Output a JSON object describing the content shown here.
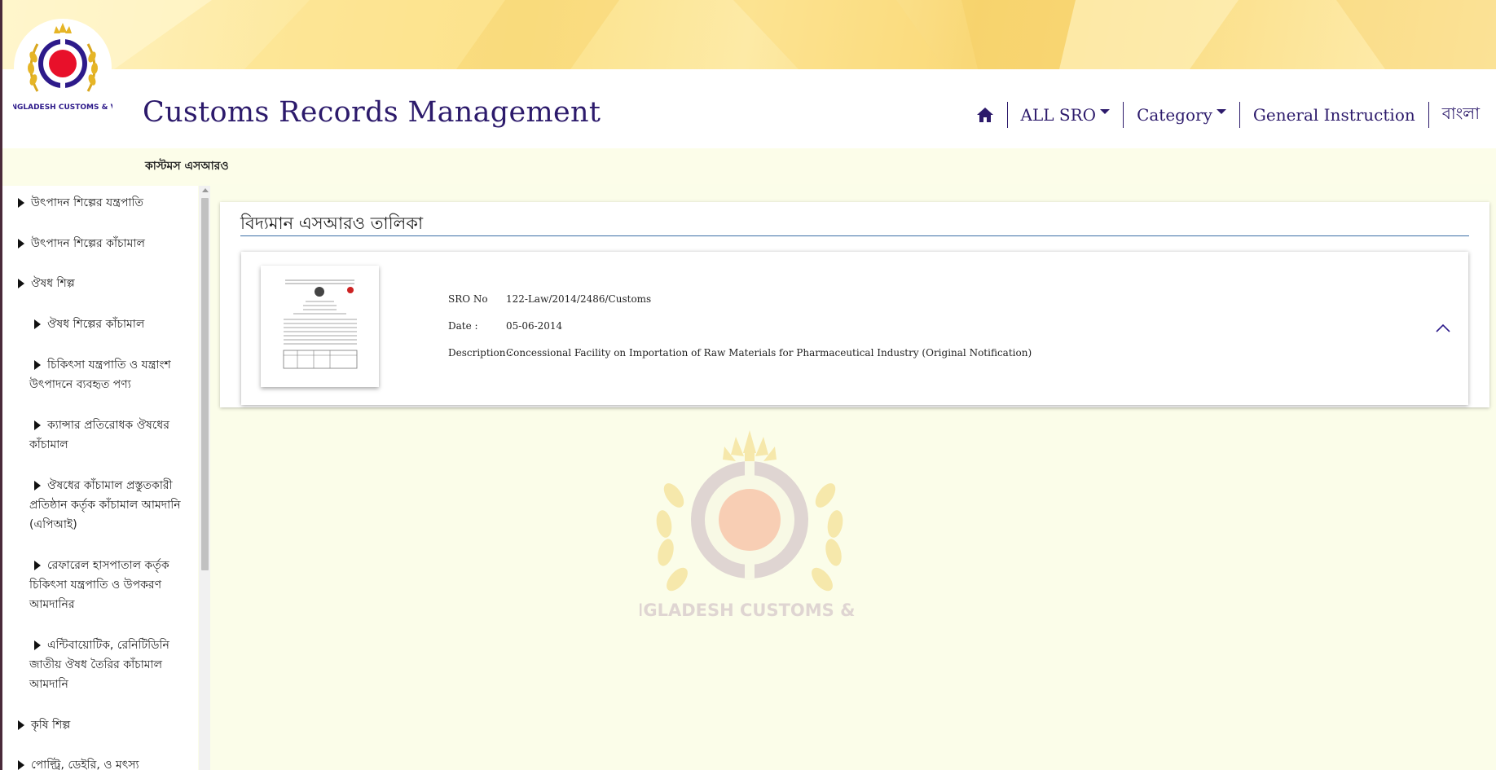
{
  "app": {
    "title": "Customs Records Management"
  },
  "logo": {
    "text": "BANGLADESH CUSTOMS & VAT"
  },
  "nav": {
    "home_icon": "home-icon",
    "items": [
      {
        "label": "ALL SRO",
        "dropdown": true
      },
      {
        "label": "Category",
        "dropdown": true
      },
      {
        "label": "General Instruction",
        "dropdown": false
      },
      {
        "label": "বাংলা",
        "dropdown": false
      }
    ]
  },
  "subbar": {
    "label": "কাস্টমস এসআরও"
  },
  "sidebar": {
    "items": [
      {
        "label": "উৎপাদন শিল্পের যন্ত্রপাতি",
        "level": 0
      },
      {
        "label": "উৎপাদন শিল্পের কাঁচামাল",
        "level": 0
      },
      {
        "label": "ঔষধ শিল্প",
        "level": 0
      },
      {
        "label": "ঔষধ শিল্পের কাঁচামাল",
        "level": 1
      },
      {
        "label_lines": [
          "চিকিৎসা যন্ত্রপাতি ও যন্ত্রাংশ",
          "উৎপাদনে ব্যবহৃত পণ্য"
        ],
        "level": 1
      },
      {
        "label_lines": [
          "ক্যান্সার প্রতিরোধক ঔষধের",
          "কাঁচামাল"
        ],
        "level": 1
      },
      {
        "label_lines": [
          "ঔষধের কাঁচামাল প্রস্তুতকারী",
          "প্রতিষ্ঠান কর্তৃক কাঁচামাল আমদানি",
          "(এপিআই)"
        ],
        "level": 1
      },
      {
        "label_lines": [
          "রেফারেল হাসপাতাল কর্তৃক",
          "চিকিৎসা যন্ত্রপাতি ও উপকরণ",
          "আমদানির"
        ],
        "level": 1
      },
      {
        "label_lines": [
          "এন্টিবায়োটিক, রেনিটিডিনি",
          "জাতীয় ঔষধ তৈরির কাঁচামাল",
          "আমদানি"
        ],
        "level": 1
      },
      {
        "label": "কৃষি শিল্প",
        "level": 0
      },
      {
        "label": "পোল্ট্রি, ডেইরি, ও মৎস্য",
        "level": 0
      }
    ]
  },
  "main": {
    "title": "বিদ্যমান এসআরও তালিকা",
    "records": [
      {
        "sro_label": "SRO No",
        "sro_no": "122-Law/2014/2486/Customs",
        "date_label": "Date :",
        "date": "05-06-2014",
        "desc_label": "Description :",
        "description": "Concessional Facility on Importation of Raw Materials for Pharmaceutical Industry (Original Notification)"
      }
    ]
  },
  "colors": {
    "brand": "#2c1a6b",
    "accent_rule": "#3a6ea5",
    "banner": "#fbe28a"
  }
}
